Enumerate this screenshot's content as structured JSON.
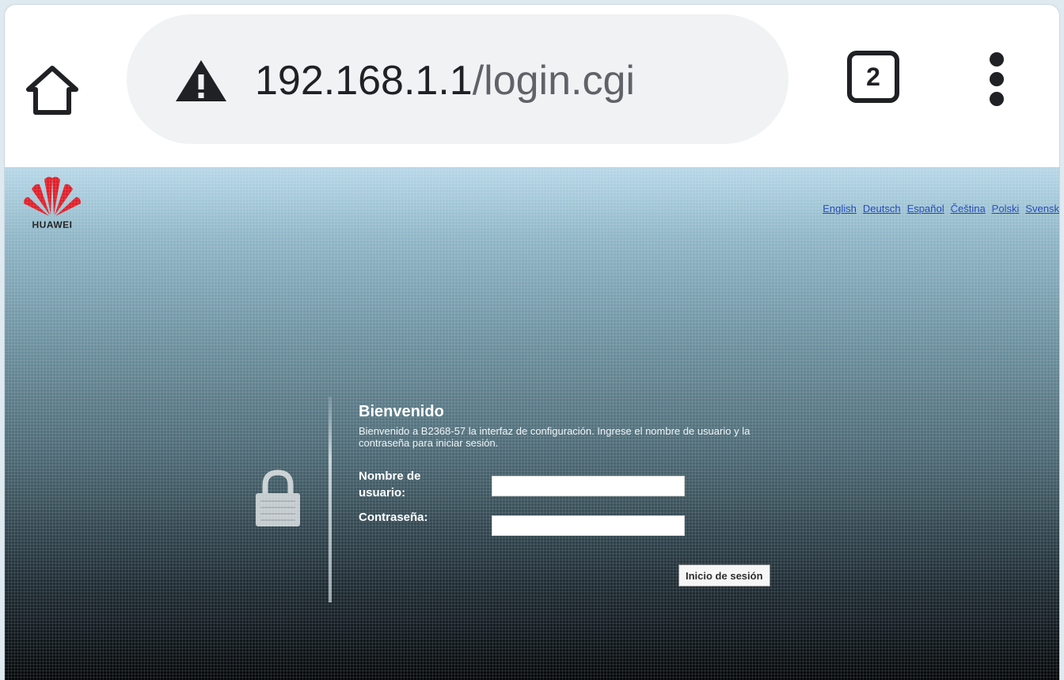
{
  "browser": {
    "url_host": "192.168.1.1",
    "url_path": "/login.cgi",
    "tab_count": "2",
    "icons": {
      "home": "home-icon",
      "security": "not-secure-warning-icon",
      "tabs": "tab-switcher-icon",
      "menu": "more-vert-icon"
    }
  },
  "header": {
    "logo_text": "HUAWEI",
    "languages": [
      "English",
      "Deutsch",
      "Español",
      "Čeština",
      "Polski",
      "Svensk"
    ]
  },
  "login": {
    "title": "Bienvenido",
    "description": "Bienvenido a B2368-57 la interfaz de configuración. Ingrese el nombre de usuario y la contraseña para iniciar sesión.",
    "username_label": "Nombre de usuario:",
    "password_label": "Contraseña:",
    "username_value": "",
    "password_value": "",
    "submit_label": "Inicio de sesión"
  },
  "colors": {
    "link": "#1d44b8",
    "logo_red": "#e0202a"
  }
}
